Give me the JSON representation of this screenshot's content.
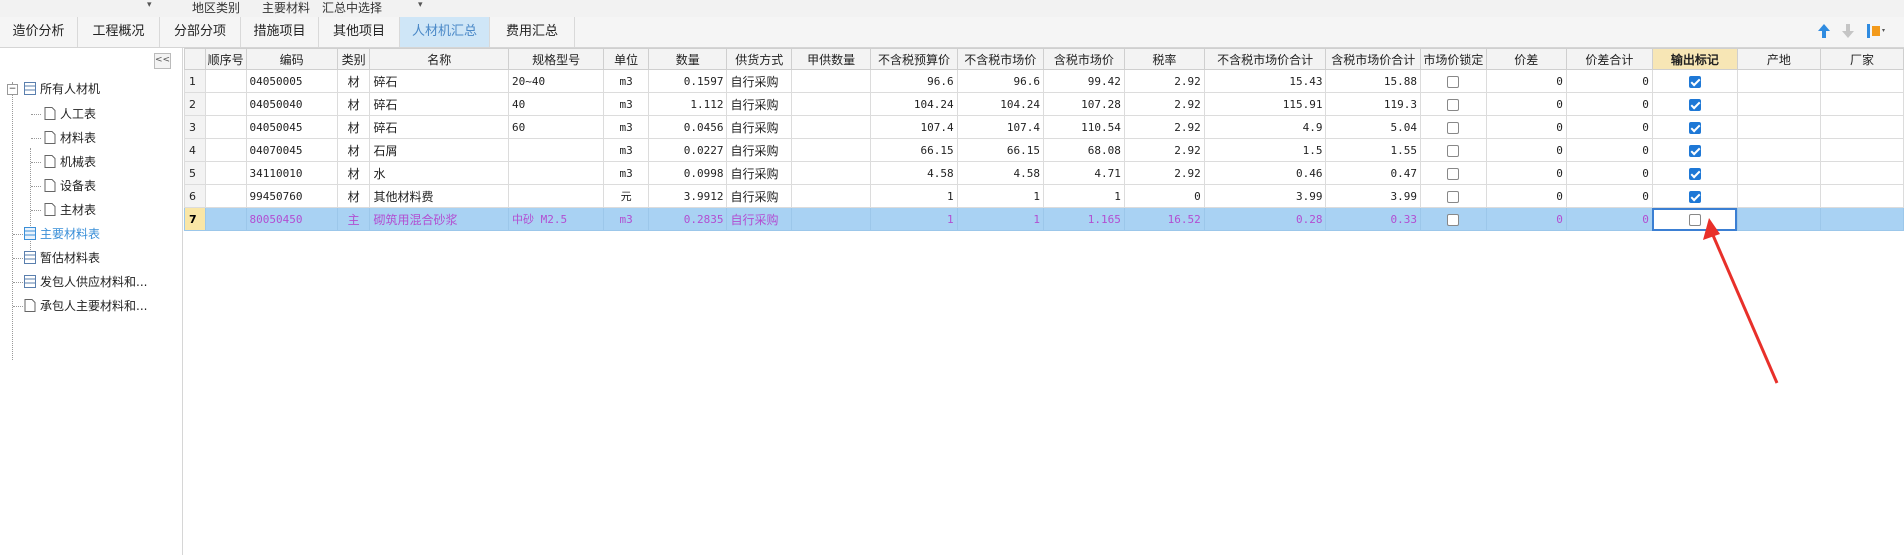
{
  "topbar": {
    "items": [
      "地区类别",
      "主要材料",
      "汇总中选择"
    ]
  },
  "tabs": [
    {
      "label": "造价分析"
    },
    {
      "label": "工程概况"
    },
    {
      "label": "分部分项"
    },
    {
      "label": "措施项目"
    },
    {
      "label": "其他项目"
    },
    {
      "label": "人材机汇总",
      "active": true
    },
    {
      "label": "费用汇总"
    }
  ],
  "toolbar_icons": [
    "arrow-up-icon",
    "arrow-down-icon",
    "settings-icon"
  ],
  "sidebar": {
    "collapse_icon": "<<",
    "root": {
      "label": "所有人材机",
      "expanded": true,
      "children": [
        "人工表",
        "材料表",
        "机械表",
        "设备表",
        "主材表"
      ]
    },
    "items": [
      {
        "label": "主要材料表",
        "active": true
      },
      {
        "label": "暂估材料表"
      },
      {
        "label": "发包人供应材料和..."
      },
      {
        "label": "承包人主要材料和..."
      }
    ]
  },
  "grid": {
    "columns": [
      "顺序号",
      "编码",
      "类别",
      "名称",
      "规格型号",
      "单位",
      "数量",
      "供货方式",
      "甲供数量",
      "不含税预算价",
      "不含税市场价",
      "含税市场价",
      "税率",
      "不含税市场价合计",
      "含税市场价合计",
      "市场价锁定",
      "价差",
      "价差合计",
      "输出标记",
      "产地",
      "厂家"
    ],
    "highlight_column": "输出标记",
    "rows": [
      {
        "rn": "1",
        "seq": "",
        "code": "04050005",
        "cat": "材",
        "name": "碎石",
        "spec": "20~40",
        "unit": "m3",
        "qty": "0.1597",
        "supply": "自行采购",
        "jqty": "",
        "bp": "96.6",
        "mp": "96.6",
        "tmp": "99.42",
        "tax": "2.92",
        "mpt": "15.43",
        "tmpt": "15.88",
        "lock": false,
        "diff": "0",
        "difft": "0",
        "out": true,
        "origin": "",
        "maker": ""
      },
      {
        "rn": "2",
        "seq": "",
        "code": "04050040",
        "cat": "材",
        "name": "碎石",
        "spec": "40",
        "unit": "m3",
        "qty": "1.112",
        "supply": "自行采购",
        "jqty": "",
        "bp": "104.24",
        "mp": "104.24",
        "tmp": "107.28",
        "tax": "2.92",
        "mpt": "115.91",
        "tmpt": "119.3",
        "lock": false,
        "diff": "0",
        "difft": "0",
        "out": true,
        "origin": "",
        "maker": ""
      },
      {
        "rn": "3",
        "seq": "",
        "code": "04050045",
        "cat": "材",
        "name": "碎石",
        "spec": "60",
        "unit": "m3",
        "qty": "0.0456",
        "supply": "自行采购",
        "jqty": "",
        "bp": "107.4",
        "mp": "107.4",
        "tmp": "110.54",
        "tax": "2.92",
        "mpt": "4.9",
        "tmpt": "5.04",
        "lock": false,
        "diff": "0",
        "difft": "0",
        "out": true,
        "origin": "",
        "maker": ""
      },
      {
        "rn": "4",
        "seq": "",
        "code": "04070045",
        "cat": "材",
        "name": "石屑",
        "spec": "",
        "unit": "m3",
        "qty": "0.0227",
        "supply": "自行采购",
        "jqty": "",
        "bp": "66.15",
        "mp": "66.15",
        "tmp": "68.08",
        "tax": "2.92",
        "mpt": "1.5",
        "tmpt": "1.55",
        "lock": false,
        "diff": "0",
        "difft": "0",
        "out": true,
        "origin": "",
        "maker": ""
      },
      {
        "rn": "5",
        "seq": "",
        "code": "34110010",
        "cat": "材",
        "name": "水",
        "spec": "",
        "unit": "m3",
        "qty": "0.0998",
        "supply": "自行采购",
        "jqty": "",
        "bp": "4.58",
        "mp": "4.58",
        "tmp": "4.71",
        "tax": "2.92",
        "mpt": "0.46",
        "tmpt": "0.47",
        "lock": false,
        "diff": "0",
        "difft": "0",
        "out": true,
        "origin": "",
        "maker": ""
      },
      {
        "rn": "6",
        "seq": "",
        "code": "99450760",
        "cat": "材",
        "name": "其他材料费",
        "spec": "",
        "unit": "元",
        "qty": "3.9912",
        "supply": "自行采购",
        "jqty": "",
        "bp": "1",
        "mp": "1",
        "tmp": "1",
        "tax": "0",
        "mpt": "3.99",
        "tmpt": "3.99",
        "lock": false,
        "diff": "0",
        "difft": "0",
        "out": true,
        "origin": "",
        "maker": ""
      },
      {
        "rn": "7",
        "seq": "",
        "code": "80050450",
        "cat": "主",
        "name": "砌筑用混合砂浆",
        "spec": "中砂 M2.5",
        "unit": "m3",
        "qty": "0.2835",
        "supply": "自行采购",
        "jqty": "",
        "bp": "1",
        "mp": "1",
        "tmp": "1.165",
        "tax": "16.52",
        "mpt": "0.28",
        "tmpt": "0.33",
        "lock": false,
        "diff": "0",
        "difft": "0",
        "out": false,
        "origin": "",
        "maker": "",
        "selected": true
      }
    ]
  },
  "colors": {
    "accent": "#3a8fd8",
    "selected_row": "#a9d2f3",
    "selected_text": "#b24ed1",
    "header_highlight": "#f7e6b5",
    "arrow": "#e8302a"
  }
}
